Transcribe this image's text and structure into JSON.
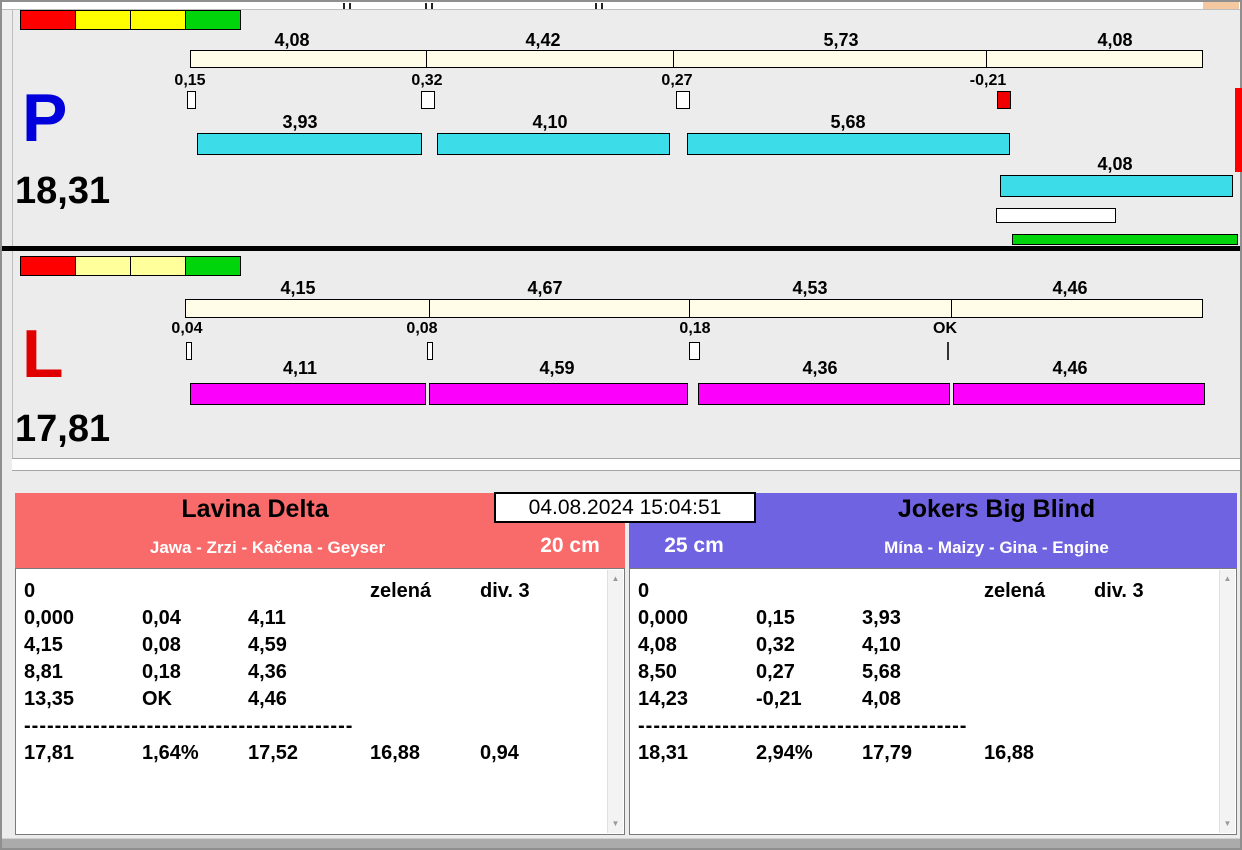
{
  "datetime": "04.08.2024 15:04:51",
  "icons": {
    "scroll_up": "▲",
    "scroll_down": "▼"
  },
  "lights": {
    "p": [
      "#ff0000",
      "#ffff00",
      "#ffff00",
      "#00d40a"
    ],
    "l": [
      "#ff0000",
      "#ffff9c",
      "#ffff9c",
      "#00d40a"
    ]
  },
  "colors": {
    "lane_p_bar": "#3cdce8",
    "lane_l_bar": "#fb00fb",
    "team_left_header": "#f96b6b",
    "team_right_header": "#6f63e2",
    "split_bar": "#fffde8",
    "fault_marker": "#f00000",
    "finish_green": "#00d40a"
  },
  "lanes": {
    "p": {
      "letter": "P",
      "total": "18,31",
      "splits": [
        "4,08",
        "4,42",
        "5,73",
        "4,08"
      ],
      "crossovers": [
        "0,15",
        "0,32",
        "0,27",
        "-0,21"
      ],
      "dog_times": [
        "3,93",
        "4,10",
        "5,68"
      ],
      "dog_time_4": "4,08"
    },
    "l": {
      "letter": "L",
      "total": "17,81",
      "splits": [
        "4,15",
        "4,67",
        "4,53",
        "4,46"
      ],
      "crossovers": [
        "0,04",
        "0,08",
        "0,18",
        "OK"
      ],
      "dog_times": [
        "4,11",
        "4,59",
        "4,36",
        "4,46"
      ]
    }
  },
  "teams": {
    "left": {
      "name": "Lavina Delta",
      "dogs": "Jawa - Zrzi - Kačena - Geyser",
      "jump_height": "20 cm",
      "separator": "-------------------------------------------",
      "rows": [
        [
          "0",
          "",
          "",
          "zelená",
          "div. 3"
        ],
        [
          "0,000",
          "0,04",
          "4,11",
          "",
          ""
        ],
        [
          "4,15",
          "0,08",
          "4,59",
          "",
          ""
        ],
        [
          "8,81",
          "0,18",
          "4,36",
          "",
          ""
        ],
        [
          "13,35",
          "OK",
          "4,46",
          "",
          ""
        ],
        [
          "17,81",
          "1,64%",
          "17,52",
          "16,88",
          "0,94"
        ]
      ]
    },
    "right": {
      "name": "Jokers Big Blind",
      "dogs": "Mína - Maizy - Gina - Engine",
      "jump_height": "25 cm",
      "separator": "-------------------------------------------",
      "rows": [
        [
          "0",
          "",
          "",
          "zelená",
          "div. 3"
        ],
        [
          "0,000",
          "0,15",
          "3,93",
          "",
          ""
        ],
        [
          "4,08",
          "0,32",
          "4,10",
          "",
          ""
        ],
        [
          "8,50",
          "0,27",
          "5,68",
          "",
          ""
        ],
        [
          "14,23",
          "-0,21",
          "4,08",
          "",
          ""
        ],
        [
          "18,31",
          "2,94%",
          "17,79",
          "16,88",
          ""
        ]
      ]
    }
  }
}
